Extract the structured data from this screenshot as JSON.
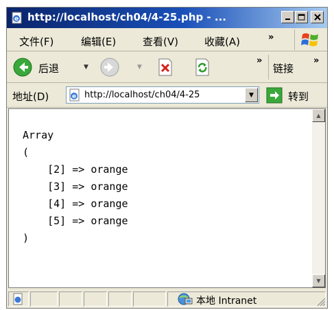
{
  "window": {
    "title": "http://localhost/ch04/4-25.php - ..."
  },
  "menu": {
    "items": [
      "文件(F)",
      "编辑(E)",
      "查看(V)",
      "收藏(A)"
    ],
    "overflow": "»"
  },
  "toolbar": {
    "back_label": "后退",
    "overflow": "»",
    "links_label": "链接",
    "links_overflow": "»"
  },
  "address": {
    "label": "地址(D)",
    "url": "http://localhost/ch04/4-25",
    "go_label": "转到"
  },
  "content": {
    "lines": [
      "Array",
      "(",
      "    [2] => orange",
      "    [3] => orange",
      "    [4] => orange",
      "    [5] => orange",
      ")"
    ]
  },
  "status": {
    "zone": "本地 Intranet"
  },
  "colors": {
    "title_gradient_start": "#0a246a",
    "title_gradient_end": "#a6caf0",
    "chrome": "#ece9d8"
  },
  "icons": [
    "ie-page-icon",
    "minimize-icon",
    "maximize-icon",
    "close-icon",
    "windows-logo-icon",
    "back-icon",
    "forward-icon",
    "stop-icon",
    "refresh-icon",
    "go-icon",
    "intranet-zone-icon"
  ]
}
